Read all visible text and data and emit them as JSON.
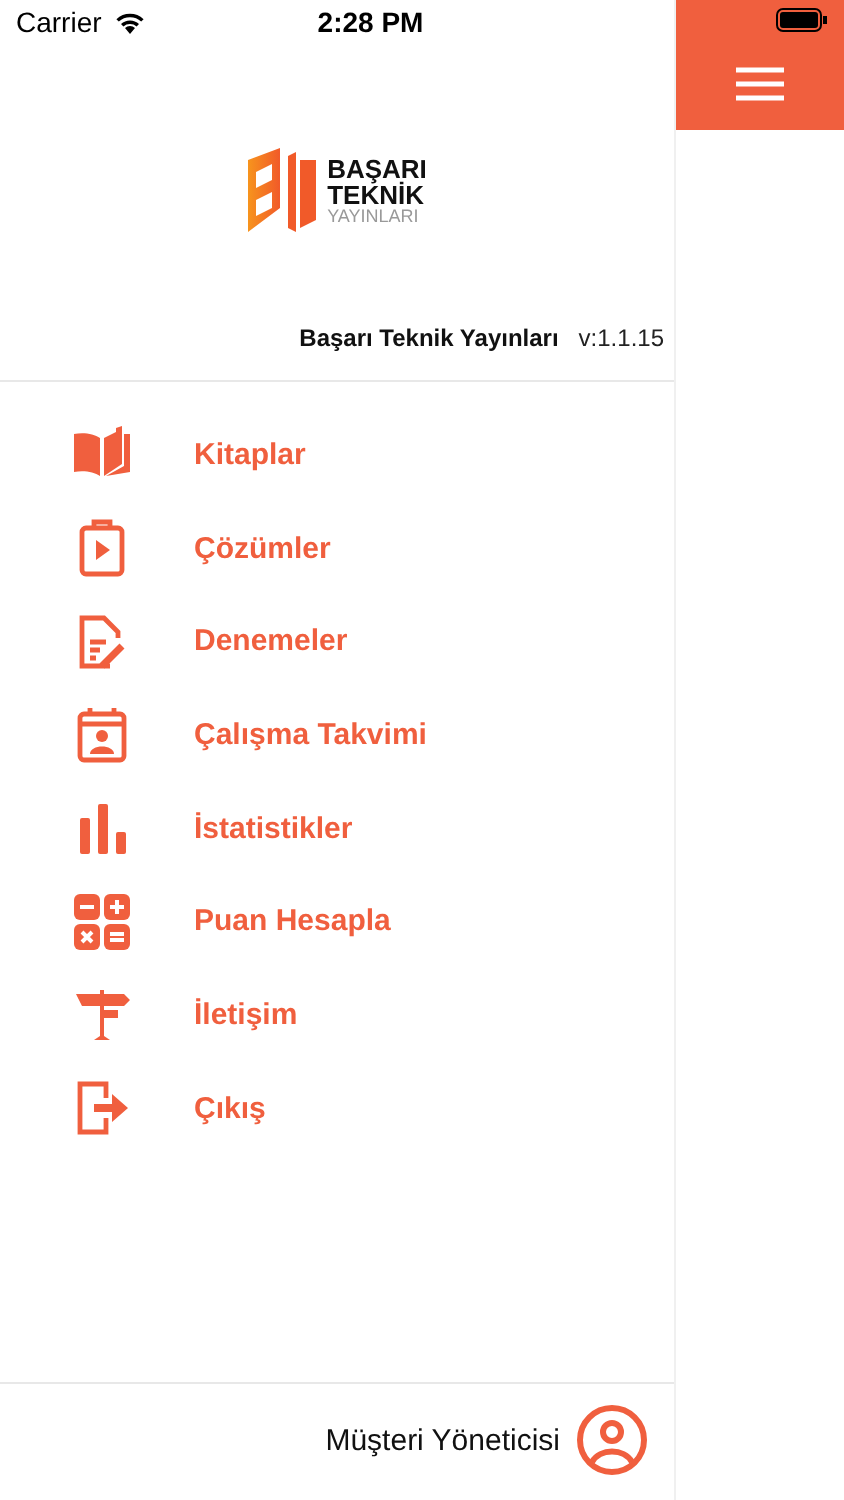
{
  "status_bar": {
    "carrier": "Carrier",
    "time": "2:28 PM"
  },
  "logo": {
    "line_1": "BAŞARI",
    "line_2": "TEKNİK",
    "line_3": "YAYINLARI"
  },
  "app_info": {
    "name": "Başarı Teknik Yayınları",
    "version": "v:1.1.15"
  },
  "menu": [
    {
      "label": "Kitaplar"
    },
    {
      "label": "Çözümler"
    },
    {
      "label": "Denemeler"
    },
    {
      "label": "Çalışma Takvimi"
    },
    {
      "label": "İstatistikler"
    },
    {
      "label": "Puan Hesapla"
    },
    {
      "label": "İletişim"
    },
    {
      "label": "Çıkış"
    }
  ],
  "footer": {
    "user": "Müşteri Yöneticisi"
  }
}
